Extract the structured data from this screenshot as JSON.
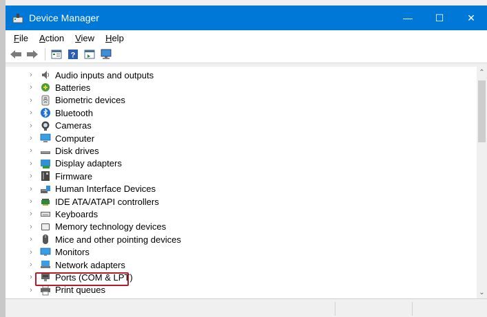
{
  "window": {
    "title": "Device Manager",
    "minimize_glyph": "—",
    "maximize_glyph": "☐",
    "close_glyph": "✕",
    "accent_color": "#0078d7"
  },
  "menu": [
    {
      "accel": "F",
      "rest": "ile"
    },
    {
      "accel": "A",
      "rest": "ction"
    },
    {
      "accel": "V",
      "rest": "iew"
    },
    {
      "accel": "H",
      "rest": "elp"
    }
  ],
  "toolbar": {
    "icons": [
      "back-arrow-icon",
      "forward-arrow-icon",
      "properties-icon",
      "help-icon",
      "update-driver-icon",
      "monitor-icon"
    ]
  },
  "tree": {
    "expander_glyph": "›",
    "categories": [
      {
        "label": "Audio inputs and outputs",
        "icon": "speaker-icon"
      },
      {
        "label": "Batteries",
        "icon": "battery-icon"
      },
      {
        "label": "Biometric devices",
        "icon": "fingerprint-icon"
      },
      {
        "label": "Bluetooth",
        "icon": "bluetooth-icon"
      },
      {
        "label": "Cameras",
        "icon": "camera-icon"
      },
      {
        "label": "Computer",
        "icon": "computer-icon"
      },
      {
        "label": "Disk drives",
        "icon": "disk-drive-icon"
      },
      {
        "label": "Display adapters",
        "icon": "display-adapter-icon"
      },
      {
        "label": "Firmware",
        "icon": "firmware-icon"
      },
      {
        "label": "Human Interface Devices",
        "icon": "hid-icon"
      },
      {
        "label": "IDE ATA/ATAPI controllers",
        "icon": "ide-controller-icon"
      },
      {
        "label": "Keyboards",
        "icon": "keyboard-icon"
      },
      {
        "label": "Memory technology devices",
        "icon": "memory-card-icon"
      },
      {
        "label": "Mice and other pointing devices",
        "icon": "mouse-icon"
      },
      {
        "label": "Monitors",
        "icon": "monitor-icon"
      },
      {
        "label": "Network adapters",
        "icon": "network-adapter-icon"
      },
      {
        "label": "Ports (COM & LPT)",
        "icon": "port-icon"
      },
      {
        "label": "Print queues",
        "icon": "printer-icon"
      }
    ],
    "highlighted": "Ports (COM & LPT)",
    "highlight_color": "#b5192a"
  },
  "scrollbar": {
    "up_glyph": "⌃",
    "down_glyph": "⌄"
  }
}
